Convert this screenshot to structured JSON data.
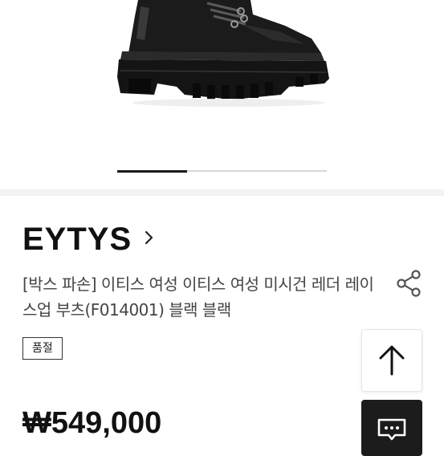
{
  "product": {
    "brand": "EYTYS",
    "title": "[박스 파손] 이티스 여성 이티스 여성 미시건 레더 레이스업 부츠(F014001) 블랙 블랙",
    "status_badge": "품절",
    "price": "₩549,000"
  },
  "gallery": {
    "total_slides": 3,
    "active_slide": 1
  },
  "icons": {
    "brand_link": "chevron-right-icon",
    "share": "share-icon",
    "scroll_top": "arrow-up-icon",
    "chat": "chat-bubble-icon"
  },
  "colors": {
    "text_primary": "#111111",
    "text_secondary": "#444444",
    "pager_active": "#1a1a1a",
    "pager_track": "#d9d9d9",
    "chat_button": "#1c1c1c"
  }
}
